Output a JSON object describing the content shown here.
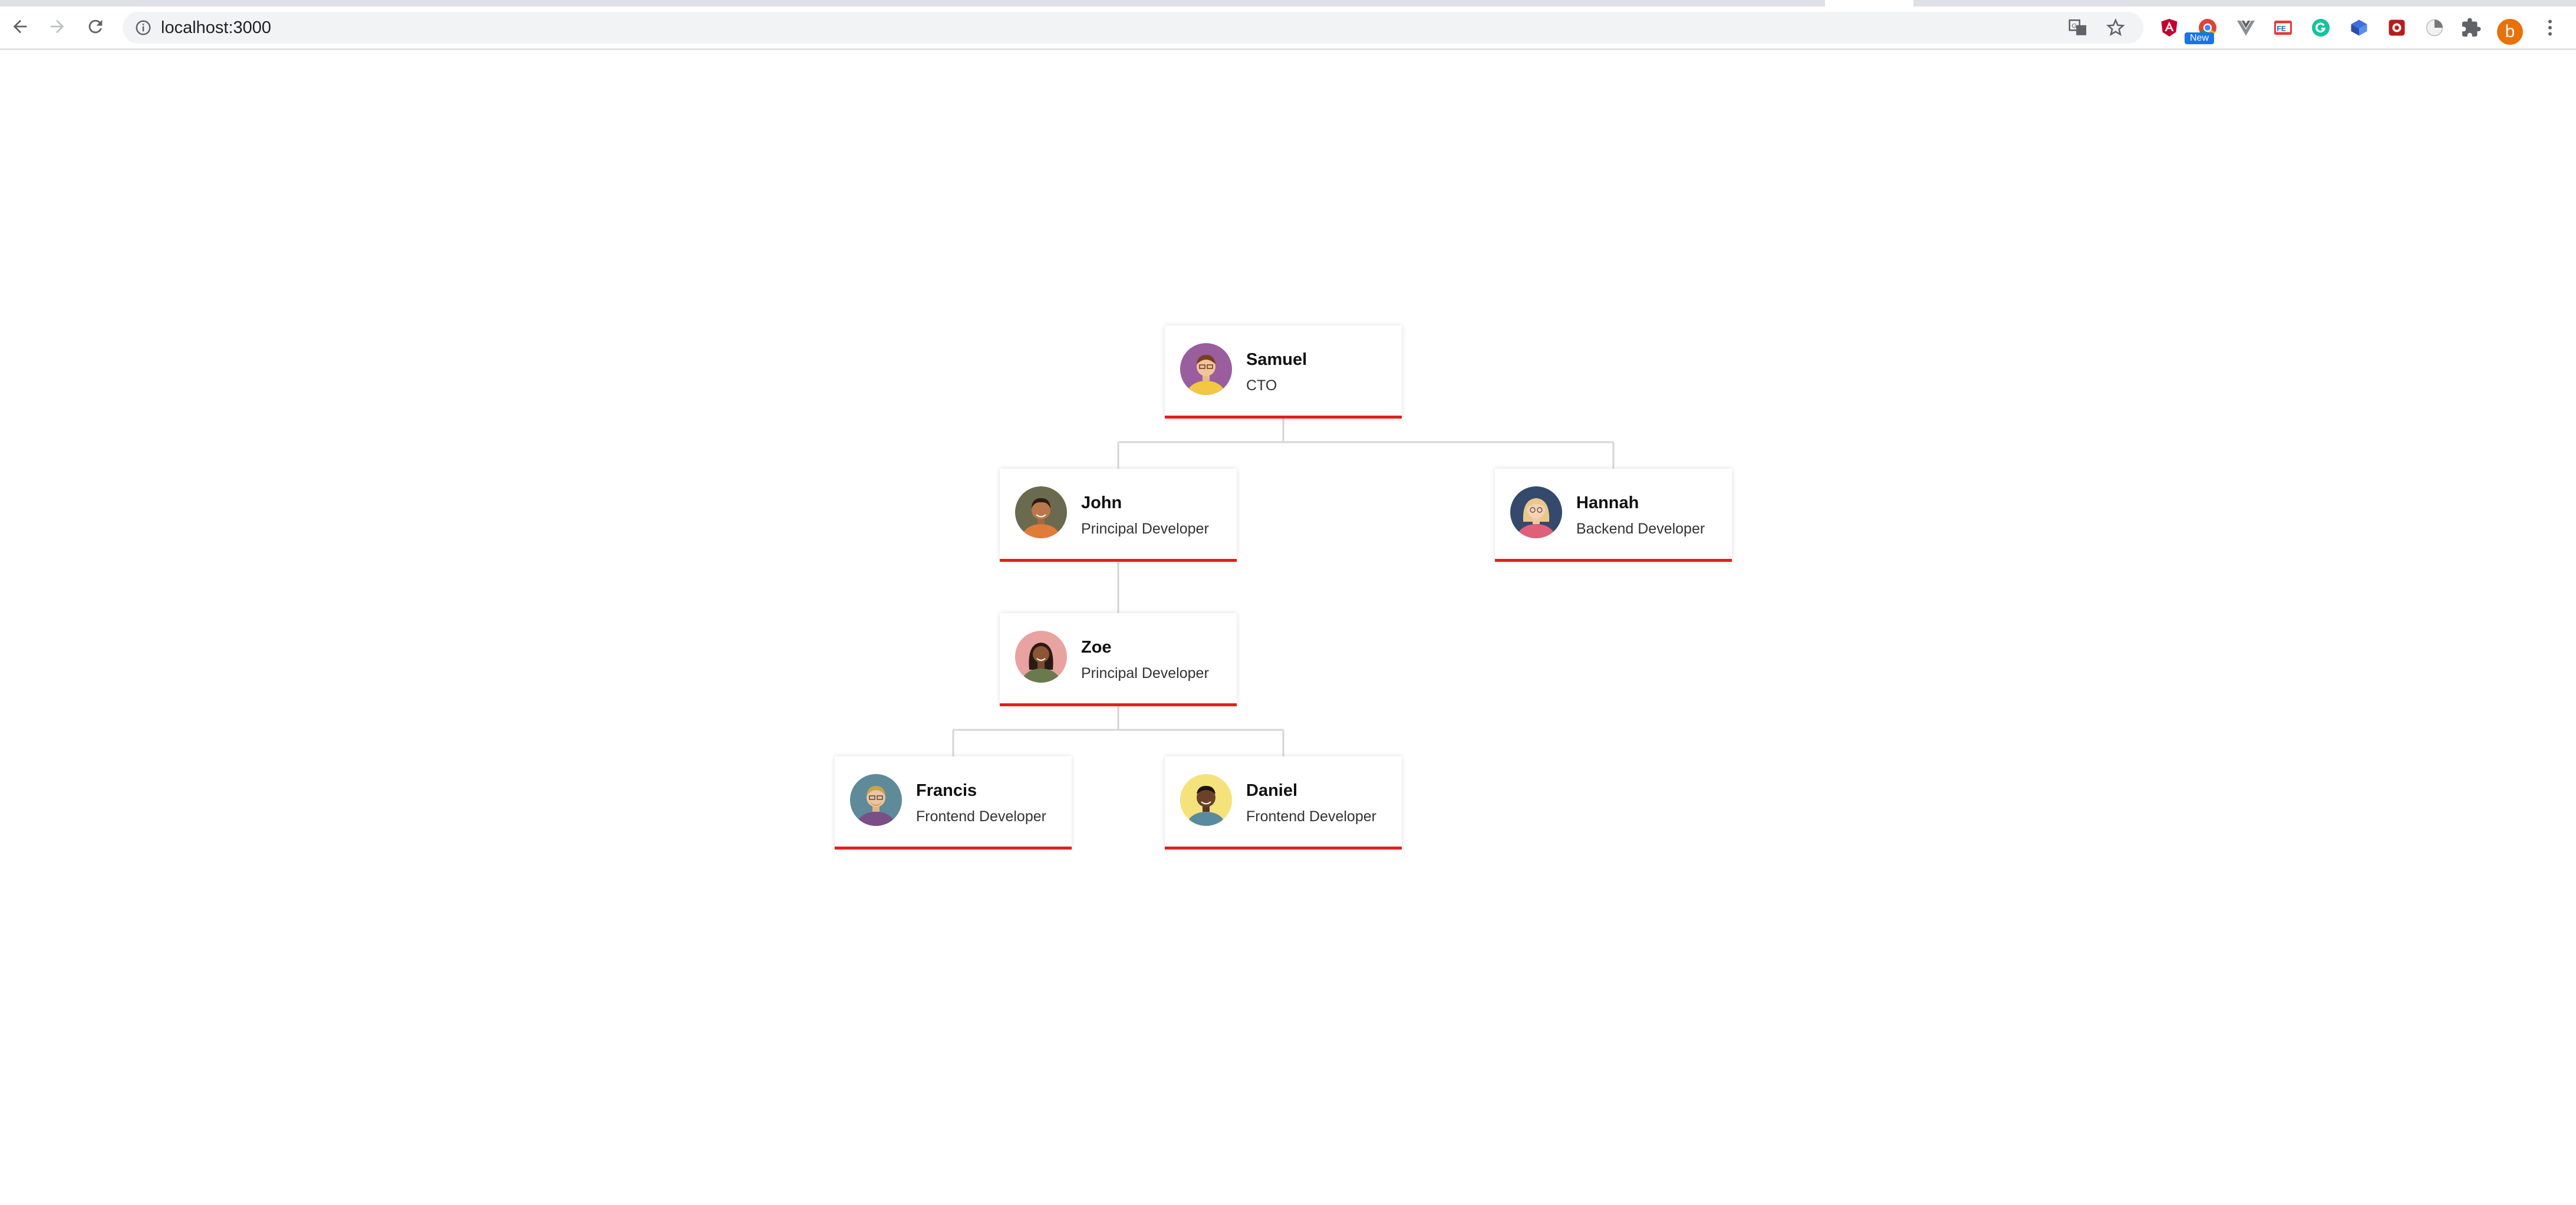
{
  "browser": {
    "url": "localhost:3000",
    "extension_badge": "New",
    "profile_initial": "b",
    "icons": [
      "back-icon",
      "forward-icon",
      "reload-icon",
      "info-icon",
      "translate-icon",
      "star-icon",
      "angular-ext-icon",
      "chrome-ext-icon",
      "vue-ext-icon",
      "fe-ext-icon",
      "grammarly-ext-icon",
      "cube-ext-icon",
      "puzzle-ext-icon",
      "menu-icon"
    ]
  },
  "org": {
    "samuel": {
      "name": "Samuel",
      "role": "CTO"
    },
    "john": {
      "name": "John",
      "role": "Principal Developer"
    },
    "hannah": {
      "name": "Hannah",
      "role": "Backend Developer"
    },
    "zoe": {
      "name": "Zoe",
      "role": "Principal Developer"
    },
    "francis": {
      "name": "Francis",
      "role": "Frontend Developer"
    },
    "daniel": {
      "name": "Daniel",
      "role": "Frontend Developer"
    }
  },
  "colors": {
    "accent": "#e02020",
    "edge": "#d6d6d6"
  }
}
